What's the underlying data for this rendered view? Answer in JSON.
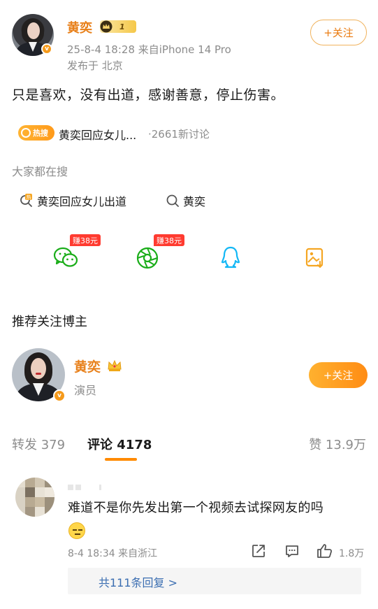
{
  "post": {
    "author": "黄奕",
    "level_num": "1",
    "time_source": "25-8-4 18:28  来自iPhone 14 Pro",
    "location": "发布于 北京",
    "follow_label": "+关注",
    "content": "只是喜欢，没有出道，感谢善意，停止伤害。"
  },
  "hot": {
    "tag_label": "热搜",
    "topic": "黄奕回应女儿...",
    "count": "·2661新讨论"
  },
  "searches": {
    "title": "大家都在搜",
    "items": [
      {
        "label": "黄奕回应女儿出道"
      },
      {
        "label": "黄奕"
      }
    ]
  },
  "share": {
    "earn_label_1": "赚38元",
    "earn_label_2": "赚38元",
    "colors": {
      "wechat": "#1aad19",
      "moments": "#1aad19",
      "qq": "#12b7f5",
      "save": "#f5a623"
    }
  },
  "recommend": {
    "title": "推荐关注博主",
    "name": "黄奕",
    "role": "演员",
    "follow_label": "+关注"
  },
  "tabs": {
    "repost": "转发 379",
    "comments": "评论 4178",
    "likes": "赞 13.9万"
  },
  "comment": {
    "text": "难道不是你先发出第一个视频去试探网友的吗",
    "time": "8-4 18:34  来自浙江",
    "likes": "1.8万",
    "replies": "共111条回复 >"
  },
  "colors": {
    "accent": "#ea7b10",
    "link": "#3b6eb1"
  }
}
